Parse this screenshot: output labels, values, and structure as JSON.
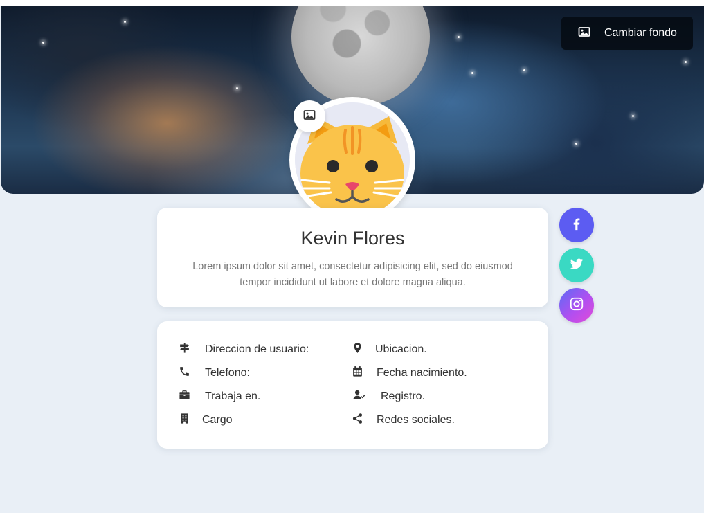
{
  "cover": {
    "change_background_label": "Cambiar fondo",
    "icon": "image-icon"
  },
  "profile": {
    "name": "Kevin Flores",
    "bio": "Lorem ipsum dolor sit amet, consectetur adipisicing elit, sed do eiusmod tempor incididunt ut labore et dolore magna aliqua.",
    "avatar_icon": "cat-avatar",
    "avatar_edit_icon": "image-icon"
  },
  "info": {
    "address": "Direccion de usuario:",
    "location": "Ubicacion.",
    "phone": "Telefono:",
    "birthdate": "Fecha nacimiento.",
    "works_at": "Trabaja en.",
    "registered": "Registro.",
    "position": "Cargo",
    "social_networks": "Redes sociales."
  },
  "social": {
    "facebook": {
      "icon": "facebook-icon",
      "color": "#5c5cf2"
    },
    "twitter": {
      "icon": "twitter-icon",
      "color": "#3ad9c3"
    },
    "instagram": {
      "icon": "instagram-icon",
      "color": "#b14ff0"
    }
  },
  "colors": {
    "page_background": "#e9eff6",
    "card_background": "#ffffff",
    "text_primary": "#333333",
    "text_muted": "#777777"
  }
}
